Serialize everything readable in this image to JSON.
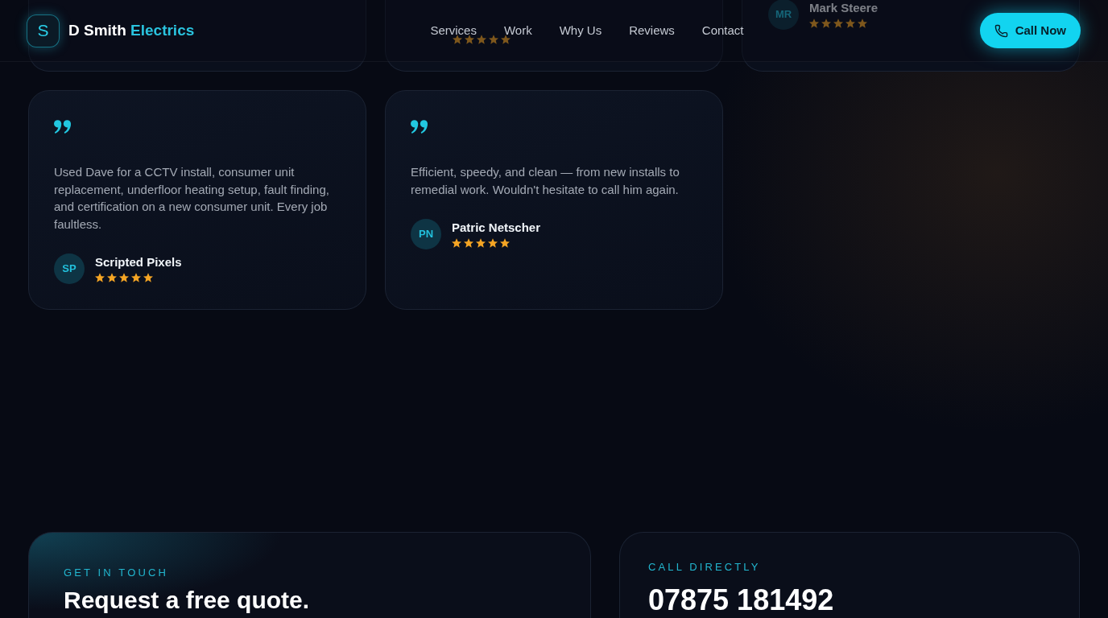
{
  "header": {
    "logo_letter": "S",
    "brand": "D Smith",
    "brand_accent": "Electrics",
    "nav": [
      {
        "label": "Services"
      },
      {
        "label": "Work"
      },
      {
        "label": "Why Us"
      },
      {
        "label": "Reviews"
      },
      {
        "label": "Contact"
      }
    ],
    "cta": {
      "label": "Call Now"
    }
  },
  "reviews_above": [
    {
      "kind": "edge"
    },
    {
      "kind": "rating",
      "stars": 5
    },
    {
      "kind": "author",
      "initials": "MR",
      "name": "Mark Steere",
      "stars": 5
    }
  ],
  "reviews": [
    {
      "text": "Used Dave for a CCTV install, consumer unit replacement, underfloor heating setup, fault finding, and certification on a new consumer unit. Every job faultless.",
      "initials": "SP",
      "name": "Scripted Pixels",
      "stars": 5
    },
    {
      "text": "Efficient, speedy, and clean — from new installs to remedial work. Wouldn't hesitate to call him again.",
      "initials": "PN",
      "name": "Patric Netscher",
      "stars": 5
    }
  ],
  "contact": {
    "eyebrow": "GET IN TOUCH",
    "heading": "Request a free quote."
  },
  "call": {
    "eyebrow": "CALL DIRECTLY",
    "phone": "07875 181492"
  }
}
